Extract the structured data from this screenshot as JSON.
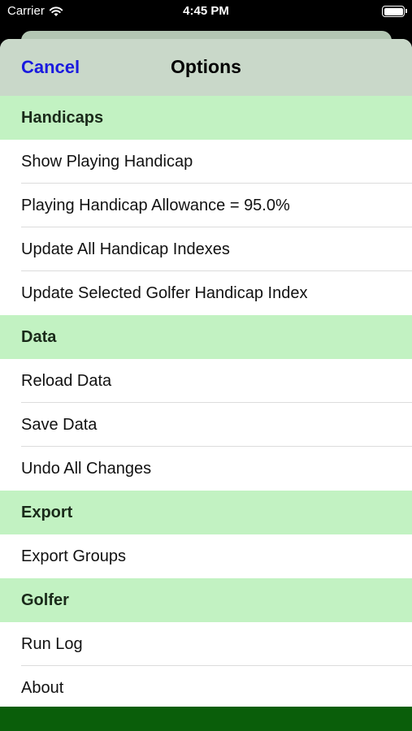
{
  "status_bar": {
    "carrier": "Carrier",
    "time": "4:45 PM",
    "wifi_icon": "wifi-icon",
    "battery_icon": "battery-icon",
    "battery_level": 1.0
  },
  "nav": {
    "cancel_label": "Cancel",
    "title": "Options"
  },
  "sections": {
    "handicaps": {
      "header": "Handicaps",
      "items": [
        "Show Playing Handicap",
        "Playing Handicap Allowance = 95.0%",
        "Update All Handicap Indexes",
        "Update Selected Golfer Handicap Index"
      ]
    },
    "data": {
      "header": "Data",
      "items": [
        "Reload Data",
        "Save Data",
        "Undo All Changes"
      ]
    },
    "export": {
      "header": "Export",
      "items": [
        "Export Groups"
      ]
    },
    "golfer": {
      "header": "Golfer",
      "items": [
        "Run Log",
        "About"
      ]
    }
  },
  "colors": {
    "section_header_bg": "#c2f2c2",
    "nav_bg": "#c9d8c9",
    "cancel_text": "#1a1adf",
    "bottom_bar": "#0a5e0a"
  }
}
